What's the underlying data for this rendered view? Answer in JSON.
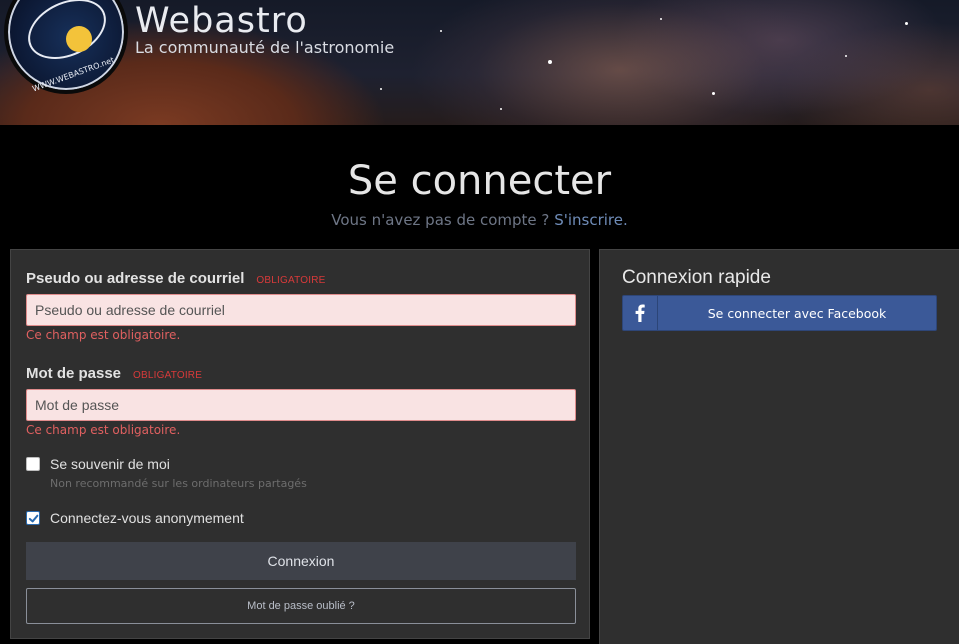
{
  "header": {
    "site_title": "Webastro",
    "tagline": "La communauté de l'astronomie",
    "logo_text": "WWW.WEBASTRO.net"
  },
  "page": {
    "title": "Se connecter",
    "no_account_text": "Vous n'avez pas de compte ?",
    "signup_link": "S'inscrire."
  },
  "login_form": {
    "username_label": "Pseudo ou adresse de courriel",
    "username_required": "OBLIGATOIRE",
    "username_placeholder": "Pseudo ou adresse de courriel",
    "username_value": "",
    "username_error": "Ce champ est obligatoire.",
    "password_label": "Mot de passe",
    "password_required": "OBLIGATOIRE",
    "password_placeholder": "Mot de passe",
    "password_value": "",
    "password_error": "Ce champ est obligatoire.",
    "remember_label": "Se souvenir de moi",
    "remember_checked": false,
    "remember_hint": "Non recommandé sur les ordinateurs partagés",
    "anonymous_label": "Connectez-vous anonymement",
    "anonymous_checked": true,
    "submit_label": "Connexion",
    "forgot_label": "Mot de passe oublié ?"
  },
  "quick_login": {
    "title": "Connexion rapide",
    "facebook_label": "Se connecter avec Facebook",
    "facebook_icon": "facebook-icon"
  },
  "colors": {
    "background": "#000000",
    "panel": "#2f2f2f",
    "error": "#e06060",
    "required": "#d83a3a",
    "facebook": "#3b5998",
    "signup_link": "#6f8cb8"
  }
}
